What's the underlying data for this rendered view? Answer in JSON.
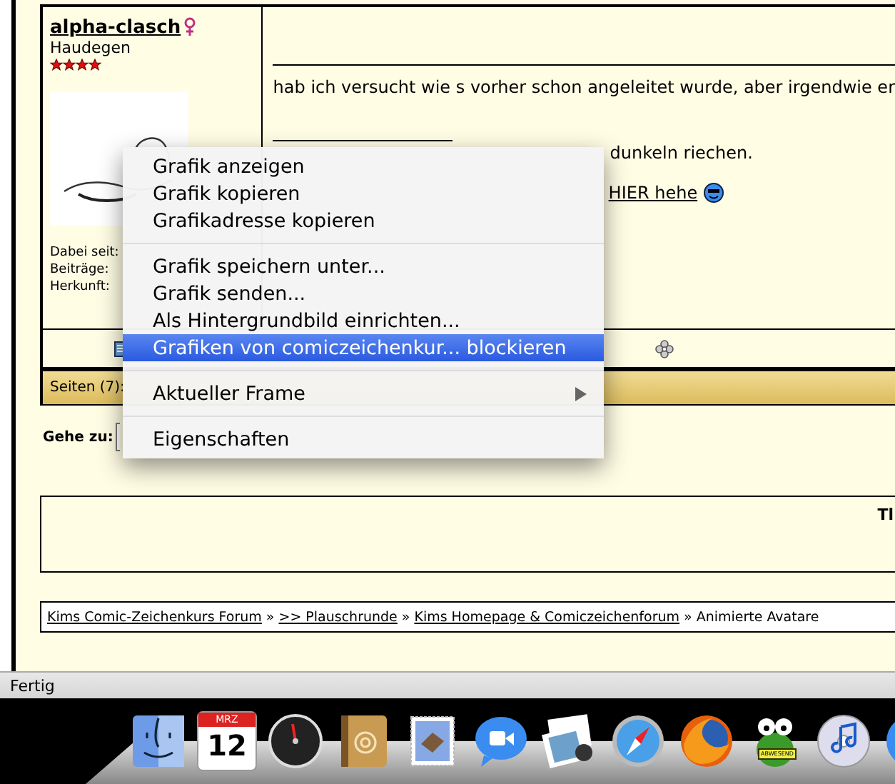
{
  "post": {
    "author": "alpha-clasch",
    "rank": "Haudegen",
    "stars": 4,
    "info_labels": [
      "Dabei seit:",
      "Beiträge:",
      "Herkunft:"
    ],
    "message": "hab ich versucht wie s vorher schon angeleitet wurde, aber irgendwie er",
    "signature": "dunkeln riechen.",
    "signature_link": "HIER hehe"
  },
  "pagination": {
    "label": "Seiten (7):"
  },
  "jump": {
    "label": "Gehe zu:"
  },
  "info_box": {
    "text": "Tl"
  },
  "breadcrumb": [
    {
      "kind": "link",
      "text": "Kims Comic-Zeichenkurs Forum"
    },
    {
      "kind": "separator",
      "text": "»"
    },
    {
      "kind": "link",
      "text": ">> Plauschrunde"
    },
    {
      "kind": "separator",
      "text": "»"
    },
    {
      "kind": "link",
      "text": "Kims Homepage & Comiczeichenforum"
    },
    {
      "kind": "separator",
      "text": "»"
    },
    {
      "kind": "current",
      "text": "Animierte Avatare"
    }
  ],
  "context_menu": {
    "items": [
      {
        "kind": "item",
        "label": "Grafik anzeigen",
        "selected": false
      },
      {
        "kind": "item",
        "label": "Grafik kopieren",
        "selected": false
      },
      {
        "kind": "item",
        "label": "Grafikadresse kopieren",
        "selected": false
      },
      {
        "kind": "separator"
      },
      {
        "kind": "item",
        "label": "Grafik speichern unter...",
        "selected": false
      },
      {
        "kind": "item",
        "label": "Grafik senden...",
        "selected": false
      },
      {
        "kind": "item",
        "label": "Als Hintergrundbild einrichten...",
        "selected": false
      },
      {
        "kind": "item",
        "label": "Grafiken von comiczeichenkur... blockieren",
        "selected": true
      },
      {
        "kind": "separator"
      },
      {
        "kind": "submenu",
        "label": "Aktueller Frame",
        "selected": false
      },
      {
        "kind": "separator"
      },
      {
        "kind": "item",
        "label": "Eigenschaften",
        "selected": false
      }
    ]
  },
  "status_bar": {
    "text": "Fertig"
  },
  "dock": {
    "calendar_month": "MRZ",
    "calendar_day": "12",
    "away_sign": "ABWESEND"
  }
}
